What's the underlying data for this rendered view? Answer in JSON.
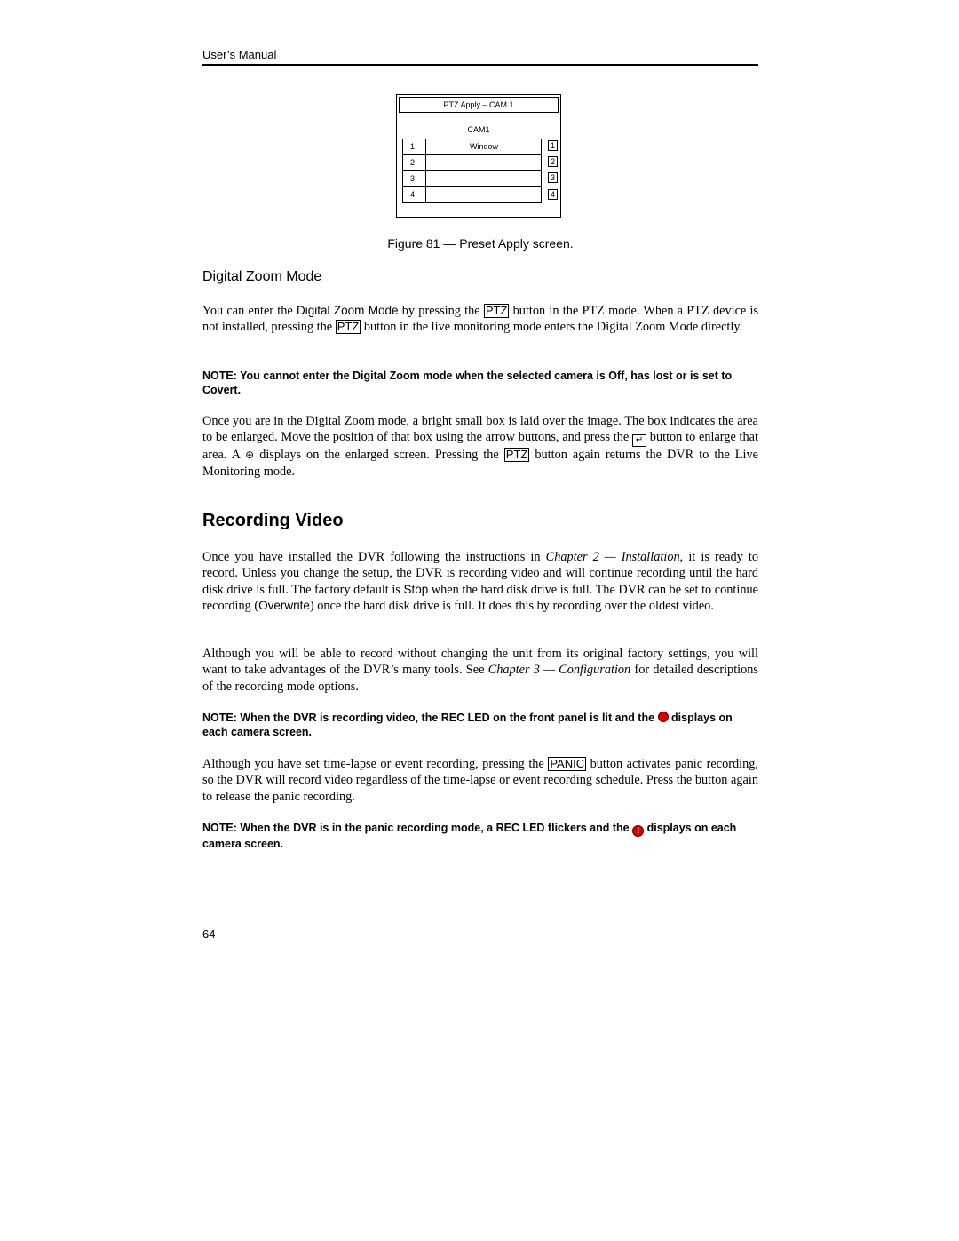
{
  "header": {
    "title": "User’s Manual"
  },
  "figure": {
    "title": "PTZ Apply – CAM 1",
    "camera": "CAM1",
    "rows": [
      {
        "num": "1",
        "value": "Window",
        "key": "1"
      },
      {
        "num": "2",
        "value": "",
        "key": "2"
      },
      {
        "num": "3",
        "value": "",
        "key": "3"
      },
      {
        "num": "4",
        "value": "",
        "key": "4"
      }
    ],
    "caption": "Figure 81 — Preset Apply screen."
  },
  "digital_zoom": {
    "heading": "Digital Zoom Mode",
    "p1": {
      "a": "You can enter the ",
      "mode": "Digital Zoom Mode",
      "b": " by pressing the ",
      "btn1": "PTZ",
      "c": " button in the PTZ mode.  When a PTZ device is not installed, pressing the ",
      "btn2": "PTZ",
      "d": " button in the live monitoring mode enters the Digital Zoom Mode directly."
    },
    "note": "NOTE:  You cannot enter the Digital Zoom mode when the selected camera is Off, has lost or is set to Covert.",
    "p2": {
      "a": "Once you are in the Digital Zoom mode, a bright small box is laid over the image.  The box indicates the area to be enlarged.  Move the position of that box using the arrow buttons, and press the ",
      "b": " button to enlarge that area.  A ",
      "c": " displays on the enlarged screen.  Pressing the ",
      "btn": "PTZ",
      "d": " button again returns the DVR to the Live Monitoring mode."
    },
    "icons": {
      "enter": "enter-icon",
      "zoom": "zoom-in-icon"
    }
  },
  "recording": {
    "heading": "Recording Video",
    "p1": {
      "a": "Once you have installed the DVR following the instructions in ",
      "ref": "Chapter 2 — Installation",
      "b": ", it is ready to record.  Unless you change the setup, the DVR is recording video and will continue recording until the hard disk drive is full.  The factory default is ",
      "stop": "Stop",
      "c": " when the hard disk drive is full.  The DVR can be set to continue recording (",
      "overwrite": "Overwrite",
      "d": ") once the hard disk drive is full.  It does this by recording over the oldest video."
    },
    "p2": {
      "a": "Although you will be able to record without changing the unit from its original factory settings, you will want to take advantages of the DVR’s many tools.  See ",
      "ref": "Chapter 3 — Configuration",
      "b": " for detailed descriptions of the recording mode options."
    },
    "note1": {
      "a": "NOTE:  When the DVR is recording video, the REC LED on the front panel is lit and the ",
      "b": " displays on each camera screen.",
      "icon": "record-dot-icon",
      "color": "#e00000"
    },
    "p3": {
      "a": "Although you have set time-lapse or event recording, pressing the ",
      "btn": "PANIC",
      "b": " button activates panic recording, so the DVR will record video regardless of the time-lapse or event recording schedule.  Press the button again to release the panic recording."
    },
    "note2": {
      "a": "NOTE:  When the DVR is in the panic recording mode, a REC LED flickers and the ",
      "b": " displays on each camera screen.",
      "icon": "panic-record-icon",
      "glyph": "!",
      "color": "#d00000"
    }
  },
  "footer": {
    "page_number": "64"
  }
}
